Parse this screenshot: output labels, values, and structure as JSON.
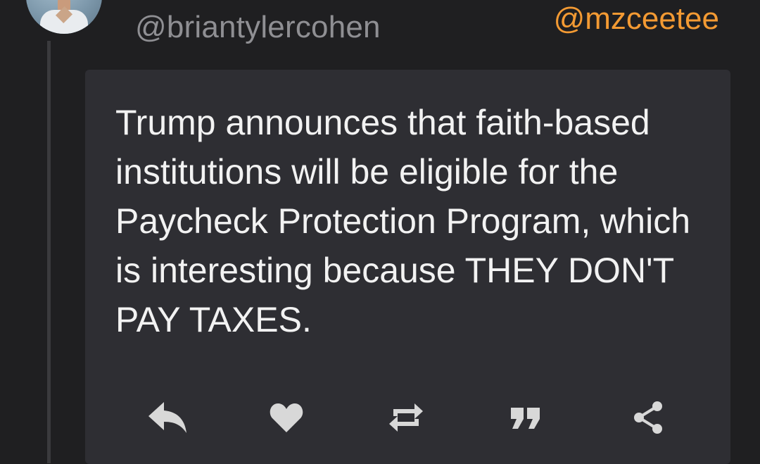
{
  "header": {
    "username": "@briantylercohen",
    "mention": "@mzceetee"
  },
  "tweet": {
    "text": "Trump announces that faith-based institutions will be eligible for the Paycheck Protection Program, which is interesting because THEY DON'T PAY TAXES."
  },
  "actions": [
    {
      "name": "reply",
      "icon": "reply-icon"
    },
    {
      "name": "like",
      "icon": "heart-icon"
    },
    {
      "name": "retweet",
      "icon": "retweet-icon"
    },
    {
      "name": "quote",
      "icon": "quote-icon"
    },
    {
      "name": "share",
      "icon": "share-icon"
    }
  ],
  "colors": {
    "background": "#1f1f21",
    "card": "#2e2e33",
    "username": "#8f8f93",
    "mention": "#f39a33",
    "text": "#f2f2f2",
    "icon": "#d8d8d8"
  }
}
